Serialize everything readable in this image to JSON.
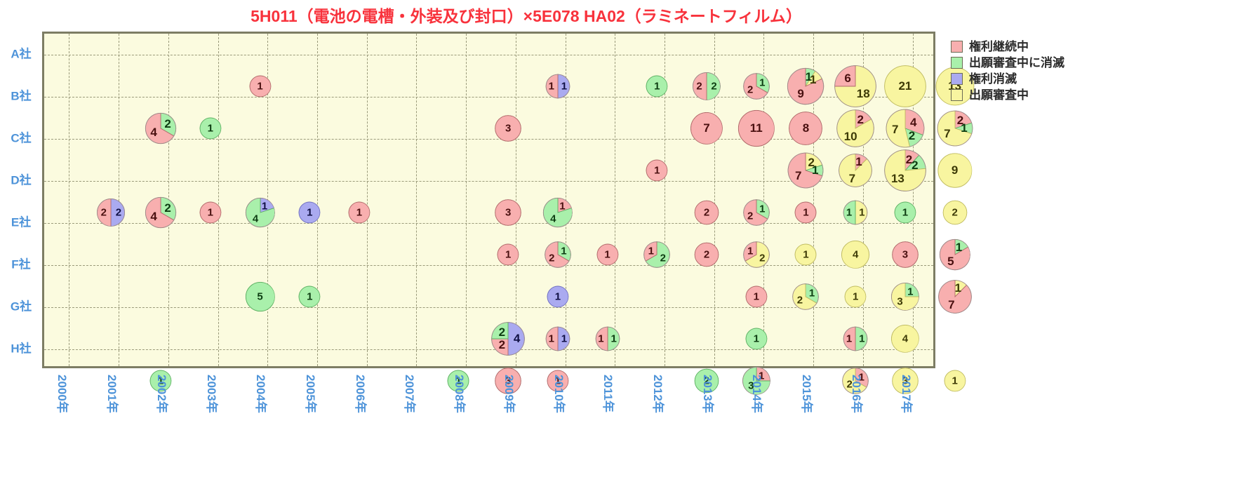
{
  "title": "5H011（電池の電槽・外装及び封口）×5E078 HA02（ラミネートフィルム）",
  "colors": {
    "red": "#f8afaf",
    "green": "#a9f0ab",
    "blue": "#aaaaf0",
    "yellow": "#f8f5a0",
    "title": "#f8323c",
    "axis_label": "#4d93d9",
    "plot_bg": "#fbfbdf",
    "plot_border": "#7d7d64",
    "grid": "#9a9a7a"
  },
  "legend": [
    {
      "key": "red",
      "label": "権利継続中",
      "color": "#f8afaf"
    },
    {
      "key": "green",
      "label": "出願審査中に消滅",
      "color": "#a9f0ab"
    },
    {
      "key": "blue",
      "label": "権利消滅",
      "color": "#aaaaf0"
    },
    {
      "key": "yellow",
      "label": "出願審査中",
      "color": "#f8f5a0"
    }
  ],
  "rows": [
    "A社",
    "B社",
    "C社",
    "D社",
    "E社",
    "F社",
    "G社",
    "H社"
  ],
  "columns": [
    "2000年",
    "2001年",
    "2002年",
    "2003年",
    "2004年",
    "2005年",
    "2006年",
    "2007年",
    "2008年",
    "2009年",
    "2010年",
    "2011年",
    "2012年",
    "2013年",
    "2014年",
    "2015年",
    "2016年",
    "2017年"
  ],
  "chart_data": {
    "type": "pie",
    "title": "5H011（電池の電槽・外装及び封口）×5E078 HA02（ラミネートフィルム）",
    "xlabel": "",
    "ylabel": "",
    "legend_position": "right",
    "grid": true,
    "description": "Matrix of pie charts: rows are companies (A社〜H社), columns are application years (2000年〜2017年). Each pie is sized by total count and split into status segments.",
    "series_keys": [
      "red",
      "green",
      "blue",
      "yellow"
    ],
    "cells": [
      {
        "row": "A社",
        "col": "2003年",
        "total": 1,
        "segments": [
          {
            "k": "red",
            "v": 1
          }
        ]
      },
      {
        "row": "A社",
        "col": "2009年",
        "total": 2,
        "segments": [
          {
            "k": "blue",
            "v": 1
          },
          {
            "k": "red",
            "v": 1
          }
        ]
      },
      {
        "row": "A社",
        "col": "2011年",
        "total": 1,
        "segments": [
          {
            "k": "green",
            "v": 1
          }
        ]
      },
      {
        "row": "A社",
        "col": "2012年",
        "total": 4,
        "segments": [
          {
            "k": "green",
            "v": 2
          },
          {
            "k": "red",
            "v": 2
          }
        ]
      },
      {
        "row": "A社",
        "col": "2013年",
        "total": 3,
        "segments": [
          {
            "k": "green",
            "v": 1
          },
          {
            "k": "red",
            "v": 2
          }
        ]
      },
      {
        "row": "A社",
        "col": "2014年",
        "total": 11,
        "segments": [
          {
            "k": "green",
            "v": 1
          },
          {
            "k": "yellow",
            "v": 1
          },
          {
            "k": "red",
            "v": 9
          }
        ]
      },
      {
        "row": "A社",
        "col": "2015年",
        "total": 24,
        "segments": [
          {
            "k": "yellow",
            "v": 18
          },
          {
            "k": "red",
            "v": 6
          }
        ]
      },
      {
        "row": "A社",
        "col": "2016年",
        "total": 21,
        "segments": [
          {
            "k": "yellow",
            "v": 21
          }
        ]
      },
      {
        "row": "A社",
        "col": "2017年",
        "total": 13,
        "segments": [
          {
            "k": "yellow",
            "v": 13
          }
        ]
      },
      {
        "row": "B社",
        "col": "2001年",
        "total": 6,
        "segments": [
          {
            "k": "green",
            "v": 2
          },
          {
            "k": "red",
            "v": 4
          }
        ]
      },
      {
        "row": "B社",
        "col": "2002年",
        "total": 1,
        "segments": [
          {
            "k": "green",
            "v": 1
          }
        ]
      },
      {
        "row": "B社",
        "col": "2008年",
        "total": 3,
        "segments": [
          {
            "k": "red",
            "v": 3
          }
        ]
      },
      {
        "row": "B社",
        "col": "2012年",
        "total": 7,
        "segments": [
          {
            "k": "red",
            "v": 7
          }
        ]
      },
      {
        "row": "B社",
        "col": "2013年",
        "total": 11,
        "segments": [
          {
            "k": "red",
            "v": 11
          }
        ]
      },
      {
        "row": "B社",
        "col": "2014年",
        "total": 8,
        "segments": [
          {
            "k": "red",
            "v": 8
          }
        ]
      },
      {
        "row": "B社",
        "col": "2015年",
        "total": 12,
        "segments": [
          {
            "k": "red",
            "v": 2
          },
          {
            "k": "yellow",
            "v": 10
          }
        ]
      },
      {
        "row": "B社",
        "col": "2016年",
        "total": 13,
        "segments": [
          {
            "k": "red",
            "v": 4
          },
          {
            "k": "green",
            "v": 2
          },
          {
            "k": "yellow",
            "v": 7
          }
        ]
      },
      {
        "row": "B社",
        "col": "2017年",
        "total": 10,
        "segments": [
          {
            "k": "red",
            "v": 2
          },
          {
            "k": "green",
            "v": 1
          },
          {
            "k": "yellow",
            "v": 7
          }
        ]
      },
      {
        "row": "C社",
        "col": "2011年",
        "total": 1,
        "segments": [
          {
            "k": "red",
            "v": 1
          }
        ]
      },
      {
        "row": "C社",
        "col": "2014年",
        "total": 10,
        "segments": [
          {
            "k": "yellow",
            "v": 2
          },
          {
            "k": "green",
            "v": 1
          },
          {
            "k": "red",
            "v": 7
          }
        ]
      },
      {
        "row": "C社",
        "col": "2015年",
        "total": 8,
        "segments": [
          {
            "k": "red",
            "v": 1
          },
          {
            "k": "yellow",
            "v": 7
          }
        ]
      },
      {
        "row": "C社",
        "col": "2016年",
        "total": 17,
        "segments": [
          {
            "k": "red",
            "v": 2
          },
          {
            "k": "green",
            "v": 2
          },
          {
            "k": "yellow",
            "v": 13
          }
        ]
      },
      {
        "row": "C社",
        "col": "2017年",
        "total": 9,
        "segments": [
          {
            "k": "yellow",
            "v": 9
          }
        ]
      },
      {
        "row": "D社",
        "col": "2000年",
        "total": 4,
        "segments": [
          {
            "k": "blue",
            "v": 2
          },
          {
            "k": "red",
            "v": 2
          }
        ]
      },
      {
        "row": "D社",
        "col": "2001年",
        "total": 6,
        "segments": [
          {
            "k": "green",
            "v": 2
          },
          {
            "k": "red",
            "v": 4
          }
        ]
      },
      {
        "row": "D社",
        "col": "2002年",
        "total": 1,
        "segments": [
          {
            "k": "red",
            "v": 1
          }
        ]
      },
      {
        "row": "D社",
        "col": "2003年",
        "total": 5,
        "segments": [
          {
            "k": "blue",
            "v": 1
          },
          {
            "k": "green",
            "v": 4
          }
        ]
      },
      {
        "row": "D社",
        "col": "2004年",
        "total": 1,
        "segments": [
          {
            "k": "blue",
            "v": 1
          }
        ]
      },
      {
        "row": "D社",
        "col": "2005年",
        "total": 1,
        "segments": [
          {
            "k": "red",
            "v": 1
          }
        ]
      },
      {
        "row": "D社",
        "col": "2008年",
        "total": 3,
        "segments": [
          {
            "k": "red",
            "v": 3
          }
        ]
      },
      {
        "row": "D社",
        "col": "2009年",
        "total": 5,
        "segments": [
          {
            "k": "red",
            "v": 1
          },
          {
            "k": "green",
            "v": 4
          }
        ]
      },
      {
        "row": "D社",
        "col": "2012年",
        "total": 2,
        "segments": [
          {
            "k": "red",
            "v": 2
          }
        ]
      },
      {
        "row": "D社",
        "col": "2013年",
        "total": 3,
        "segments": [
          {
            "k": "green",
            "v": 1
          },
          {
            "k": "red",
            "v": 2
          }
        ]
      },
      {
        "row": "D社",
        "col": "2014年",
        "total": 1,
        "segments": [
          {
            "k": "red",
            "v": 1
          }
        ]
      },
      {
        "row": "D社",
        "col": "2015年",
        "total": 2,
        "segments": [
          {
            "k": "yellow",
            "v": 1
          },
          {
            "k": "green",
            "v": 1
          }
        ]
      },
      {
        "row": "D社",
        "col": "2016年",
        "total": 1,
        "segments": [
          {
            "k": "green",
            "v": 1
          }
        ]
      },
      {
        "row": "D社",
        "col": "2017年",
        "total": 2,
        "segments": [
          {
            "k": "yellow",
            "v": 2
          }
        ]
      },
      {
        "row": "E社",
        "col": "2008年",
        "total": 1,
        "segments": [
          {
            "k": "red",
            "v": 1
          }
        ]
      },
      {
        "row": "E社",
        "col": "2009年",
        "total": 3,
        "segments": [
          {
            "k": "green",
            "v": 1
          },
          {
            "k": "red",
            "v": 2
          }
        ]
      },
      {
        "row": "E社",
        "col": "2010年",
        "total": 1,
        "segments": [
          {
            "k": "red",
            "v": 1
          }
        ]
      },
      {
        "row": "E社",
        "col": "2011年",
        "total": 3,
        "segments": [
          {
            "k": "green",
            "v": 2
          },
          {
            "k": "red",
            "v": 1
          }
        ]
      },
      {
        "row": "E社",
        "col": "2012年",
        "total": 2,
        "segments": [
          {
            "k": "red",
            "v": 2
          }
        ]
      },
      {
        "row": "E社",
        "col": "2013年",
        "total": 3,
        "segments": [
          {
            "k": "yellow",
            "v": 2
          },
          {
            "k": "red",
            "v": 1
          }
        ]
      },
      {
        "row": "E社",
        "col": "2014年",
        "total": 1,
        "segments": [
          {
            "k": "yellow",
            "v": 1
          }
        ]
      },
      {
        "row": "E社",
        "col": "2015年",
        "total": 4,
        "segments": [
          {
            "k": "yellow",
            "v": 4
          }
        ]
      },
      {
        "row": "E社",
        "col": "2016年",
        "total": 3,
        "segments": [
          {
            "k": "red",
            "v": 3
          }
        ]
      },
      {
        "row": "E社",
        "col": "2017年",
        "total": 6,
        "segments": [
          {
            "k": "green",
            "v": 1
          },
          {
            "k": "red",
            "v": 5
          }
        ]
      },
      {
        "row": "F社",
        "col": "2003年",
        "total": 5,
        "segments": [
          {
            "k": "green",
            "v": 5
          }
        ]
      },
      {
        "row": "F社",
        "col": "2004年",
        "total": 1,
        "segments": [
          {
            "k": "green",
            "v": 1
          }
        ]
      },
      {
        "row": "F社",
        "col": "2009年",
        "total": 1,
        "segments": [
          {
            "k": "blue",
            "v": 1
          }
        ]
      },
      {
        "row": "F社",
        "col": "2013年",
        "total": 1,
        "segments": [
          {
            "k": "red",
            "v": 1
          }
        ]
      },
      {
        "row": "F社",
        "col": "2014年",
        "total": 3,
        "segments": [
          {
            "k": "green",
            "v": 1
          },
          {
            "k": "yellow",
            "v": 2
          }
        ]
      },
      {
        "row": "F社",
        "col": "2015年",
        "total": 1,
        "segments": [
          {
            "k": "yellow",
            "v": 1
          }
        ]
      },
      {
        "row": "F社",
        "col": "2016年",
        "total": 4,
        "segments": [
          {
            "k": "green",
            "v": 1
          },
          {
            "k": "yellow",
            "v": 3
          }
        ]
      },
      {
        "row": "F社",
        "col": "2017年",
        "total": 8,
        "segments": [
          {
            "k": "yellow",
            "v": 1
          },
          {
            "k": "red",
            "v": 7
          }
        ]
      },
      {
        "row": "G社",
        "col": "2008年",
        "total": 8,
        "segments": [
          {
            "k": "blue",
            "v": 4
          },
          {
            "k": "red",
            "v": 2
          },
          {
            "k": "green",
            "v": 2
          }
        ]
      },
      {
        "row": "G社",
        "col": "2009年",
        "total": 2,
        "segments": [
          {
            "k": "blue",
            "v": 1
          },
          {
            "k": "red",
            "v": 1
          }
        ]
      },
      {
        "row": "G社",
        "col": "2010年",
        "total": 2,
        "segments": [
          {
            "k": "green",
            "v": 1
          },
          {
            "k": "red",
            "v": 1
          }
        ]
      },
      {
        "row": "G社",
        "col": "2013年",
        "total": 1,
        "segments": [
          {
            "k": "green",
            "v": 1
          }
        ]
      },
      {
        "row": "G社",
        "col": "2015年",
        "total": 2,
        "segments": [
          {
            "k": "green",
            "v": 1
          },
          {
            "k": "red",
            "v": 1
          }
        ]
      },
      {
        "row": "G社",
        "col": "2016年",
        "total": 4,
        "segments": [
          {
            "k": "yellow",
            "v": 4
          }
        ]
      },
      {
        "row": "H社",
        "col": "2001年",
        "total": 1,
        "segments": [
          {
            "k": "green",
            "v": 1
          }
        ]
      },
      {
        "row": "H社",
        "col": "2007年",
        "total": 1,
        "segments": [
          {
            "k": "green",
            "v": 1
          }
        ]
      },
      {
        "row": "H社",
        "col": "2008年",
        "total": 3,
        "segments": [
          {
            "k": "red",
            "v": 3
          }
        ]
      },
      {
        "row": "H社",
        "col": "2009年",
        "total": 1,
        "segments": [
          {
            "k": "red",
            "v": 1
          }
        ]
      },
      {
        "row": "H社",
        "col": "2012年",
        "total": 2,
        "segments": [
          {
            "k": "green",
            "v": 2
          }
        ]
      },
      {
        "row": "H社",
        "col": "2013年",
        "total": 4,
        "segments": [
          {
            "k": "red",
            "v": 1
          },
          {
            "k": "green",
            "v": 3
          }
        ]
      },
      {
        "row": "H社",
        "col": "2015年",
        "total": 3,
        "segments": [
          {
            "k": "red",
            "v": 1
          },
          {
            "k": "yellow",
            "v": 2
          }
        ]
      },
      {
        "row": "H社",
        "col": "2016年",
        "total": 3,
        "segments": [
          {
            "k": "yellow",
            "v": 3
          }
        ]
      },
      {
        "row": "H社",
        "col": "2017年",
        "total": 1,
        "segments": [
          {
            "k": "yellow",
            "v": 1
          }
        ]
      }
    ]
  }
}
